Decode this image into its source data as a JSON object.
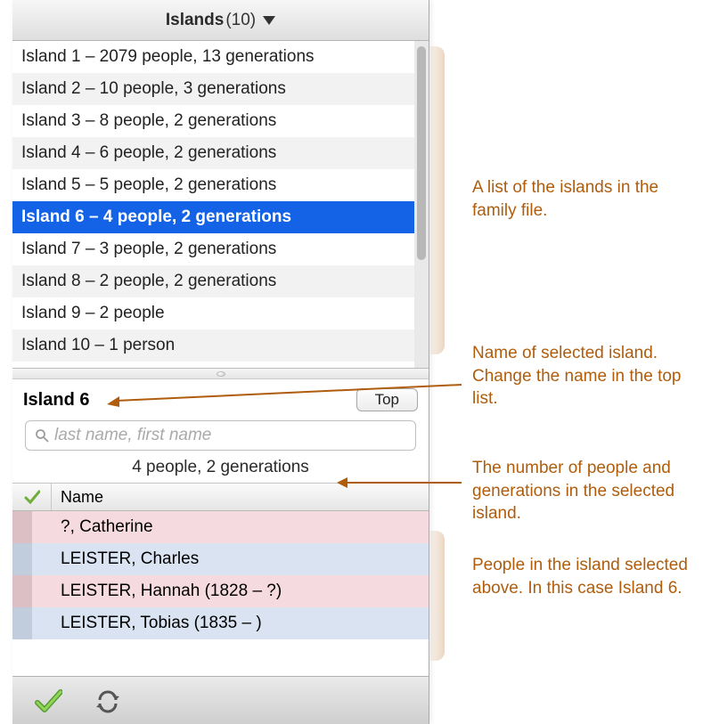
{
  "header": {
    "title": "Islands",
    "count": "(10)"
  },
  "islands": [
    {
      "label": "Island 1 – 2079 people, 13 generations",
      "selected": false
    },
    {
      "label": "Island 2 – 10 people, 3 generations",
      "selected": false
    },
    {
      "label": "Island 3 – 8 people, 2 generations",
      "selected": false
    },
    {
      "label": "Island 4 – 6 people, 2 generations",
      "selected": false
    },
    {
      "label": "Island 5 – 5 people, 2 generations",
      "selected": false
    },
    {
      "label": "Island 6 – 4 people, 2 generations",
      "selected": true
    },
    {
      "label": "Island 7 – 3 people, 2 generations",
      "selected": false
    },
    {
      "label": "Island 8 – 2 people, 2 generations",
      "selected": false
    },
    {
      "label": "Island 9 – 2 people",
      "selected": false
    },
    {
      "label": "Island 10 – 1 person",
      "selected": false
    }
  ],
  "detail": {
    "name": "Island 6",
    "top_button": "Top",
    "search_placeholder": "last name, first name",
    "summary": "4 people, 2 generations"
  },
  "table": {
    "check_header": "✔",
    "name_header": "Name"
  },
  "people": [
    {
      "name": "?, Catherine",
      "color": "pink"
    },
    {
      "name": "LEISTER, Charles",
      "color": "blue"
    },
    {
      "name": "LEISTER, Hannah (1828 – ?)",
      "color": "pink"
    },
    {
      "name": "LEISTER, Tobias (1835 – )",
      "color": "blue"
    }
  ],
  "annotations": {
    "a1": "A list of the islands in the family file.",
    "a2": "Name of selected island. Change the name in the top list.",
    "a3": "The number of people and generations in the selected island.",
    "a4": "People in the island selected above. In this case Island 6."
  }
}
